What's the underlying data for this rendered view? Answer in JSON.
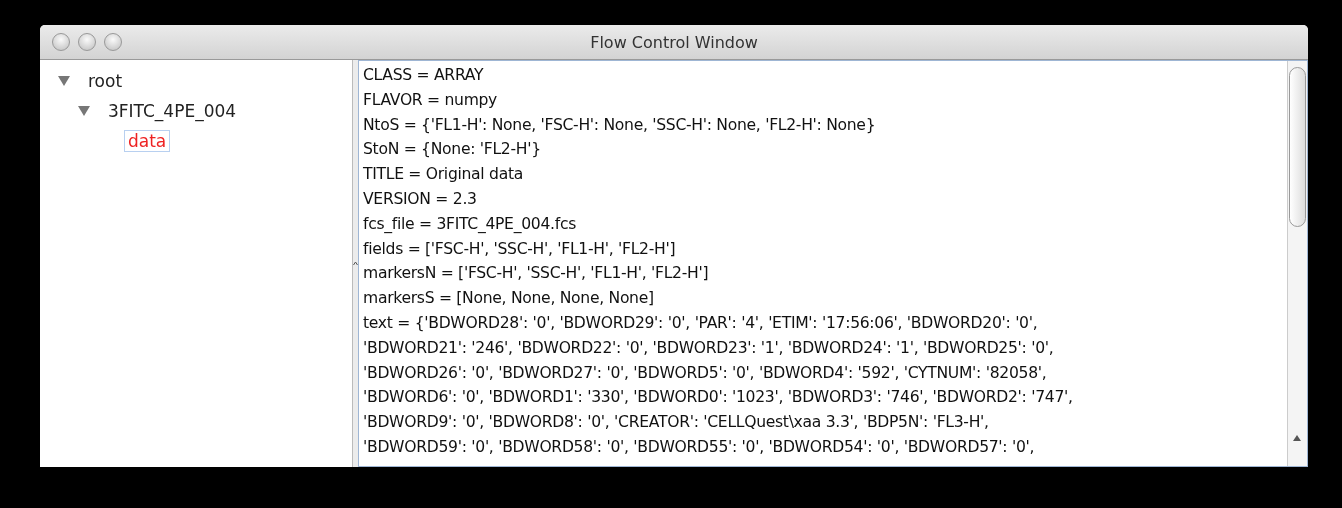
{
  "window": {
    "title": "Flow Control Window"
  },
  "tree": [
    {
      "label": "root",
      "expanded": true,
      "selected": false,
      "children": [
        {
          "label": "3FITC_4PE_004",
          "expanded": true,
          "selected": false,
          "children": [
            {
              "label": "data",
              "selected": true
            }
          ]
        }
      ]
    }
  ],
  "attributes": {
    "lines": [
      "CLASS = ARRAY",
      "FLAVOR = numpy",
      "NtoS = {'FL1-H': None, 'FSC-H': None, 'SSC-H': None, 'FL2-H': None}",
      "StoN = {None: 'FL2-H'}",
      "TITLE = Original data",
      "VERSION = 2.3",
      "fcs_file = 3FITC_4PE_004.fcs",
      "fields = ['FSC-H', 'SSC-H', 'FL1-H', 'FL2-H']",
      "markersN = ['FSC-H', 'SSC-H', 'FL1-H', 'FL2-H']",
      "markersS = [None, None, None, None]",
      "text = {'BDWORD28': '0', 'BDWORD29': '0', 'PAR': '4', 'ETIM': '17:56:06', 'BDWORD20': '0',",
      "'BDWORD21': '246', 'BDWORD22': '0', 'BDWORD23': '1', 'BDWORD24': '1', 'BDWORD25': '0',",
      "'BDWORD26': '0', 'BDWORD27': '0', 'BDWORD5': '0', 'BDWORD4': '592', 'CYTNUM': '82058',",
      "'BDWORD6': '0', 'BDWORD1': '330', 'BDWORD0': '1023', 'BDWORD3': '746', 'BDWORD2': '747',",
      "'BDWORD9': '0', 'BDWORD8': '0', 'CREATOR': 'CELLQuest\\xaa 3.3', 'BDP5N': 'FL3-H',",
      "'BDWORD59': '0', 'BDWORD58': '0', 'BDWORD55': '0', 'BDWORD54': '0', 'BDWORD57': '0',"
    ]
  }
}
